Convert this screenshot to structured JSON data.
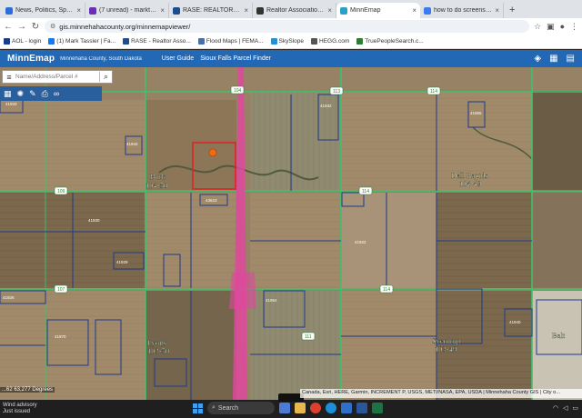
{
  "browser": {
    "tabs": [
      {
        "title": "News, Politics, Sports, Ma",
        "color": "#2a6fd8",
        "active": false
      },
      {
        "title": "(7 unread) - marktassler@",
        "color": "#6b2fb3",
        "active": false
      },
      {
        "title": "RASE: REALTOR® Associa",
        "color": "#1b4d8f",
        "active": false
      },
      {
        "title": "Realtor Association of So",
        "color": "#333333",
        "active": false
      },
      {
        "title": "MinnEmap",
        "color": "#2ba0c9",
        "active": true
      },
      {
        "title": "how to do screenshot on",
        "color": "#3b7ded",
        "active": false
      }
    ],
    "url": "gis.minnehahacounty.org/minnemapviewer/",
    "bookmarks": [
      {
        "label": "AOL - login",
        "color": "#1a3a8a"
      },
      {
        "label": "(1) Mark Tassler | Fa...",
        "color": "#1877f2"
      },
      {
        "label": "RASE - Realtor Asso...",
        "color": "#1b4d8f"
      },
      {
        "label": "Flood Maps | FEMA...",
        "color": "#4a6fa5"
      },
      {
        "label": "SkySlope",
        "color": "#2a8fd0"
      },
      {
        "label": "HEGG.com",
        "color": "#555555"
      },
      {
        "label": "TruePeopleSearch.c...",
        "color": "#2e7d32"
      }
    ]
  },
  "app": {
    "brand": "MinnEmap",
    "subtitle": "Minnehaha County, South Dakota",
    "links": [
      "User Guide",
      "Sioux Falls Parcel Finder"
    ],
    "search_placeholder": "Name/Address/Parcel #",
    "scale_text": "...62 63,277 Degrees",
    "attribution": "Canada, Esri, HERE, Garmin, INCREMENT P, USGS, METI/NASA, EPA, USDA | Minnehaha County GIS | City o..."
  },
  "map": {
    "township_labels": [
      {
        "name": "Burk",
        "code": "104-50"
      },
      {
        "name": "Dell Rapids",
        "code": "104-49"
      },
      {
        "name": "Lyons",
        "code": "103-50"
      },
      {
        "name": "Sverdrup",
        "code": "103-49"
      },
      {
        "name": "Balt",
        "code": ""
      }
    ],
    "road_badges": [
      "104",
      "113",
      "114",
      "109",
      "114",
      "107",
      "114",
      "111"
    ],
    "parcel_ids": [
      "41933",
      "41942",
      "41932",
      "41965",
      "43623",
      "41930",
      "41929",
      "41926",
      "41970",
      "41922",
      "41954",
      "41940"
    ],
    "colors": {
      "pink_highway": "#e0489f",
      "parcel_line": "#1e3a8c",
      "road_green": "#3cc46a",
      "highlight_box": "#e02424",
      "marker": "#f36a10"
    }
  },
  "taskbar": {
    "weather_line1": "Wind advisory",
    "weather_line2": "Just issued",
    "search_label": "Search"
  }
}
